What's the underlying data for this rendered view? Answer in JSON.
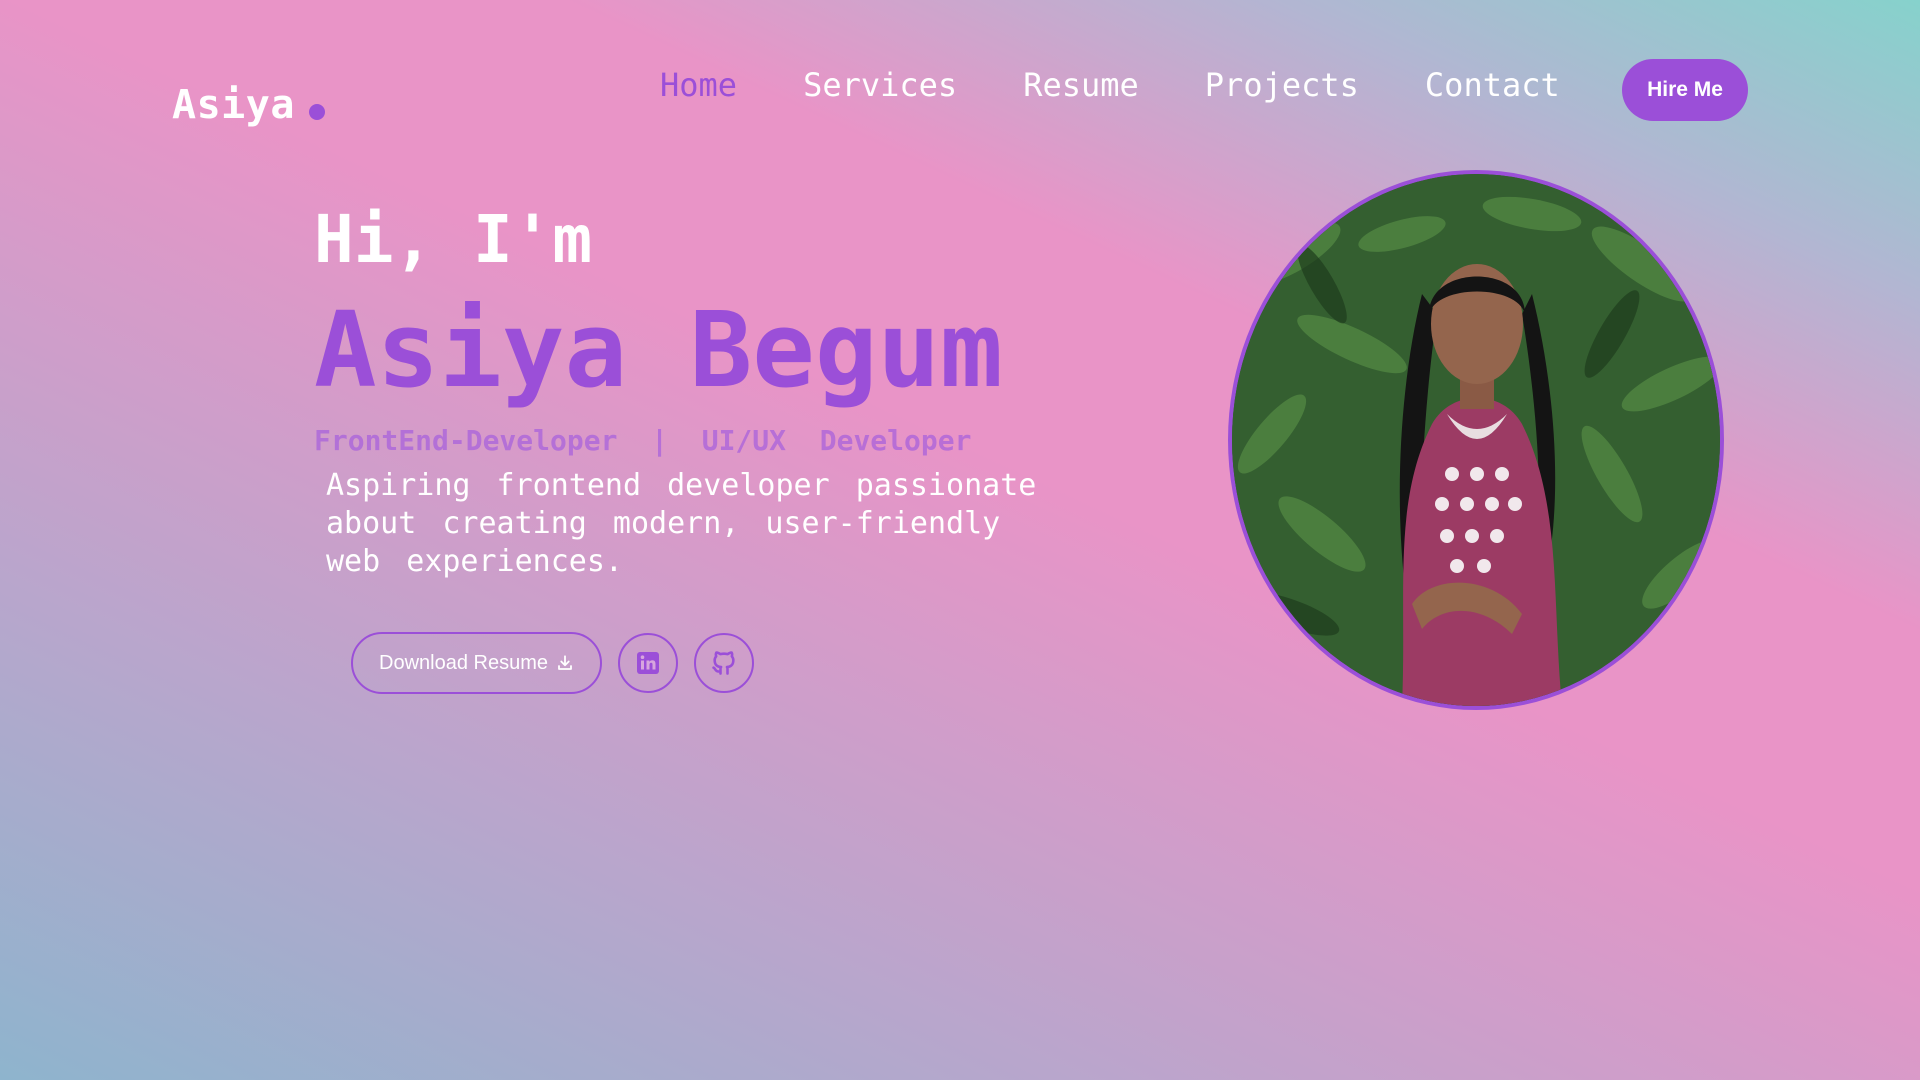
{
  "logo": {
    "text": "Asiya"
  },
  "nav": {
    "items": [
      {
        "label": "Home",
        "active": true
      },
      {
        "label": "Services"
      },
      {
        "label": "Resume"
      },
      {
        "label": "Projects"
      },
      {
        "label": "Contact"
      }
    ],
    "hire_label": "Hire Me"
  },
  "hero": {
    "greeting": "Hi, I'm",
    "name": "Asiya Begum",
    "role": "FrontEnd-Developer  |  UI/UX  Developer",
    "description": "Aspiring frontend developer passionate about creating modern, user-friendly web experiences.",
    "download_label": "Download Resume"
  },
  "icons": {
    "download": "download-icon",
    "linkedin": "linkedin-icon",
    "github": "github-icon"
  },
  "colors": {
    "accent": "#9b4fd8",
    "text": "#ffffff"
  }
}
